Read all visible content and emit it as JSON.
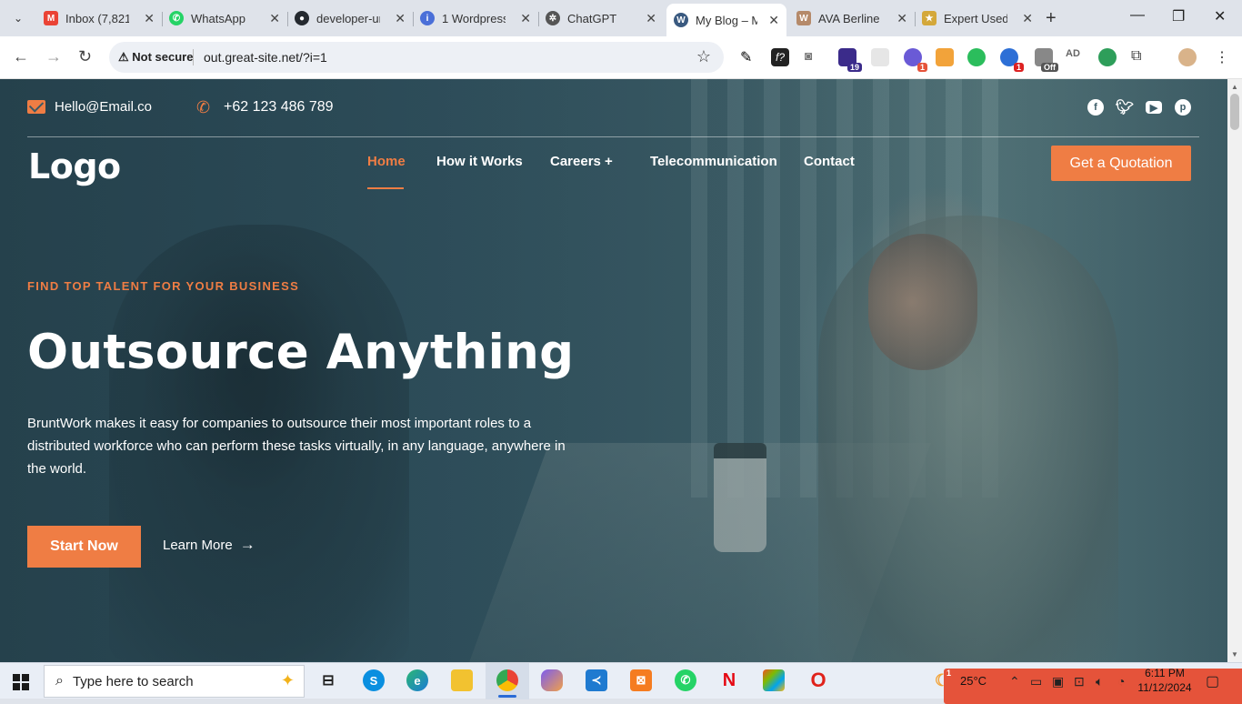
{
  "browser": {
    "tabs": [
      {
        "title": "Inbox (7,821)",
        "icon": "gmail-icon",
        "color": "#ea4335"
      },
      {
        "title": "WhatsApp",
        "icon": "whatsapp-icon",
        "color": "#25d366"
      },
      {
        "title": "developer-ur",
        "icon": "github-icon",
        "color": "#24292f"
      },
      {
        "title": "1 Wordpress",
        "icon": "info-icon",
        "color": "#4a6fd8"
      },
      {
        "title": "ChatGPT",
        "icon": "chatgpt-icon",
        "color": "#555555"
      },
      {
        "title": "My Blog – M",
        "icon": "wordpress-icon",
        "color": "#3a5a80"
      },
      {
        "title": "AVA Berline",
        "icon": "ava-icon",
        "color": "#b58a6a"
      },
      {
        "title": "Expert Used",
        "icon": "expert-icon",
        "color": "#d4a83a"
      }
    ],
    "active_tab_index": 5,
    "new_tab_glyph": "+",
    "address": {
      "security_label": "Not secure",
      "url": "out.great-site.net/?i=1"
    },
    "extension_badges": {
      "ext2": "19",
      "ext5": "1",
      "ext7": "1",
      "ext8": "Off"
    }
  },
  "site": {
    "topbar": {
      "email": "Hello@Email.co",
      "phone": "+62 123 486 789",
      "social": [
        "facebook-icon",
        "twitter-icon",
        "youtube-icon",
        "pinterest-icon"
      ]
    },
    "logo": "Logo",
    "nav": [
      {
        "label": "Home",
        "active": true
      },
      {
        "label": "How it Works",
        "active": false
      },
      {
        "label": "Careers +",
        "active": false
      },
      {
        "label": "Telecommunication",
        "active": false
      },
      {
        "label": "Contact",
        "active": false
      }
    ],
    "cta": "Get a Quotation",
    "hero": {
      "eyebrow": "FIND TOP TALENT FOR YOUR BUSINESS",
      "headline": "Outsource Anything",
      "body": "BruntWork makes it easy for companies to outsource their most important roles to a distributed workforce who can perform these tasks virtually, in any language, anywhere in the world.",
      "primary_button": "Start Now",
      "secondary_link": "Learn More"
    },
    "accent_color": "#ef7d44"
  },
  "taskbar": {
    "search_placeholder": "Type here to search",
    "apps": [
      "task-view-icon",
      "skype-icon",
      "edge-icon",
      "file-explorer-icon",
      "chrome-icon",
      "copilot-icon",
      "vscode-icon",
      "xampp-icon",
      "whatsapp-icon",
      "netflix-icon",
      "store-icon",
      "opera-icon"
    ],
    "weather": "25°C",
    "weather_badge": "1",
    "time": "6:11 PM",
    "date": "11/12/2024"
  }
}
